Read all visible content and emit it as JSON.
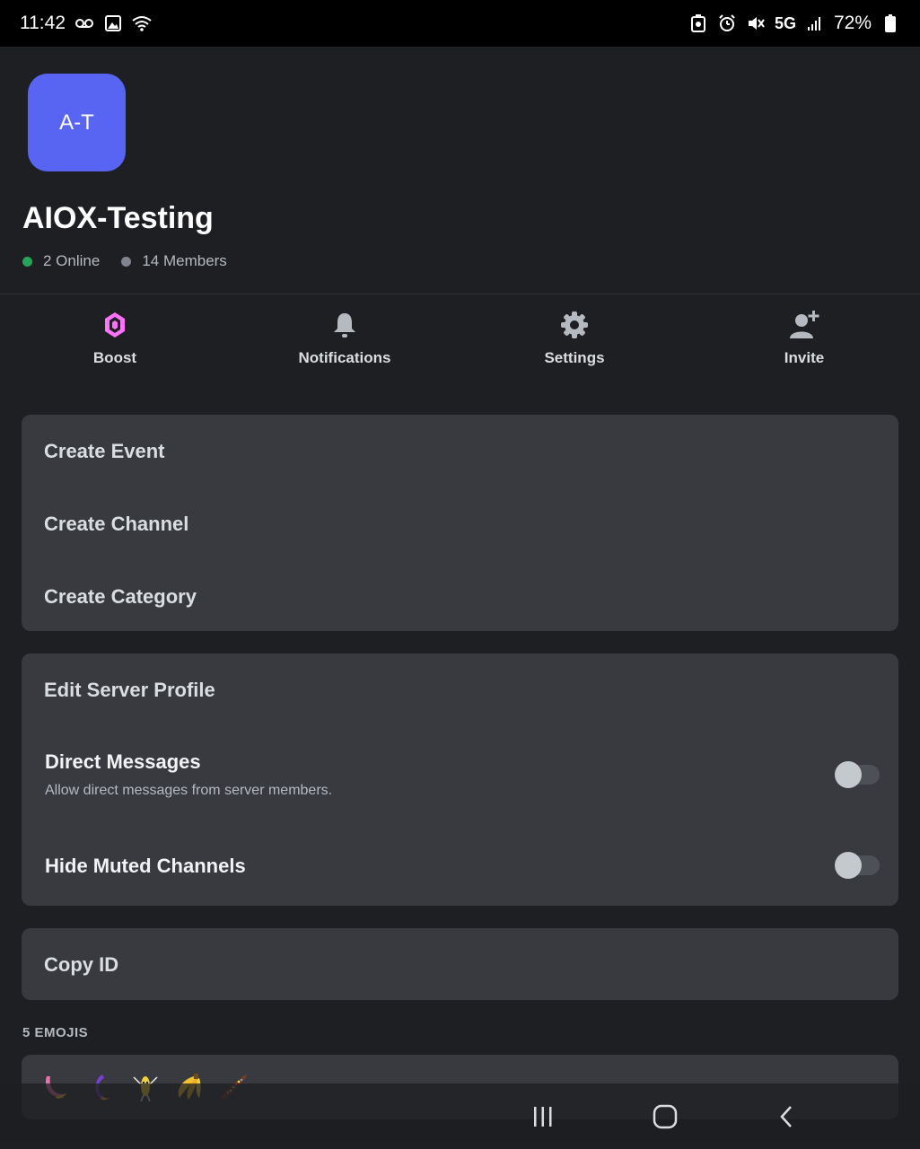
{
  "status_bar": {
    "time": "11:42",
    "network": "5G",
    "battery": "72%"
  },
  "server": {
    "icon_text": "A-T",
    "icon_color": "#5865f2",
    "name": "AIOX-Testing",
    "online": "2 Online",
    "members": "14 Members",
    "online_color": "#23a55a",
    "members_color": "#80848e"
  },
  "actions": [
    {
      "label": "Boost",
      "icon": "boost-icon"
    },
    {
      "label": "Notifications",
      "icon": "bell-icon"
    },
    {
      "label": "Settings",
      "icon": "gear-icon"
    },
    {
      "label": "Invite",
      "icon": "add-user-icon"
    }
  ],
  "create_menu": {
    "items": [
      "Create Event",
      "Create Channel",
      "Create Category"
    ]
  },
  "profile_menu": {
    "edit_profile": "Edit Server Profile",
    "direct_messages": {
      "title": "Direct Messages",
      "subtitle": "Allow direct messages from server members.",
      "enabled": false
    },
    "hide_muted": {
      "title": "Hide Muted Channels",
      "enabled": false
    }
  },
  "copy_menu": {
    "copy_id": "Copy ID"
  },
  "emojis": {
    "label": "5 EMOJIS",
    "items": [
      "emoji-pink-banana",
      "emoji-purple-banana",
      "emoji-dancing-banana",
      "emoji-banana-bunch",
      "emoji-chocolate-banana"
    ]
  },
  "nav": {
    "icons": [
      "recent-apps-icon",
      "home-icon",
      "back-icon"
    ]
  }
}
